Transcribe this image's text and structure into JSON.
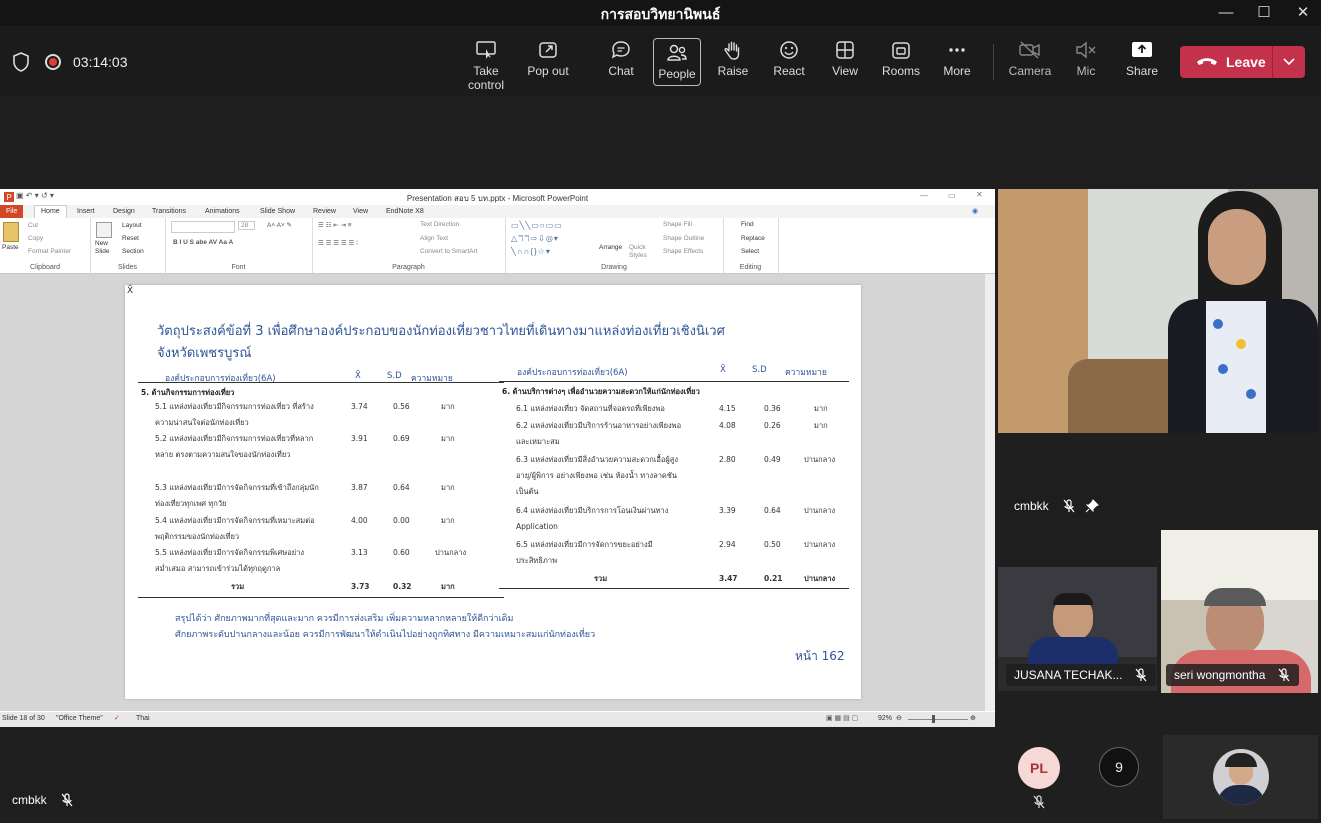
{
  "window": {
    "title": "การสอบวิทยานิพนธ์",
    "minimize": "—",
    "maximize": "☐",
    "close": "✕"
  },
  "call": {
    "timer": "03:14:03"
  },
  "toolbar": {
    "buttons": [
      {
        "label": "Take control",
        "icon": "take-control-icon"
      },
      {
        "label": "Pop out",
        "icon": "pop-out-icon"
      },
      {
        "label": "Chat",
        "icon": "chat-icon"
      },
      {
        "label": "People",
        "icon": "people-icon"
      },
      {
        "label": "Raise",
        "icon": "raise-hand-icon"
      },
      {
        "label": "React",
        "icon": "react-icon"
      },
      {
        "label": "View",
        "icon": "view-icon"
      },
      {
        "label": "Rooms",
        "icon": "rooms-icon"
      },
      {
        "label": "More",
        "icon": "more-icon"
      },
      {
        "label": "Camera",
        "icon": "camera-off-icon"
      },
      {
        "label": "Mic",
        "icon": "mic-off-icon"
      },
      {
        "label": "Share",
        "icon": "share-icon"
      }
    ],
    "leave_label": "Leave",
    "leave_color": "#c4314b"
  },
  "powerpoint": {
    "title": "Presentation สอบ 5 บท.pptx  -  Microsoft PowerPoint",
    "tabs": [
      "File",
      "Home",
      "Insert",
      "Design",
      "Transitions",
      "Animations",
      "Slide Show",
      "Review",
      "View",
      "EndNote X8"
    ],
    "ribbon": {
      "clipboard": {
        "paste": "Paste",
        "cut": "Cut",
        "copy": "Copy",
        "format_painter": "Format Painter",
        "group": "Clipboard"
      },
      "slides": {
        "new_slide": "New Slide",
        "layout": "Layout",
        "reset": "Reset",
        "section": "Section",
        "group": "Slides"
      },
      "font": {
        "size": "28",
        "group": "Font"
      },
      "paragraph": {
        "text_direction": "Text Direction",
        "align_text": "Align Text",
        "convert": "Convert to SmartArt",
        "group": "Paragraph"
      },
      "drawing": {
        "arrange": "Arrange",
        "quick_styles": "Quick Styles",
        "shape_fill": "Shape Fill",
        "shape_outline": "Shape Outline",
        "shape_effects": "Shape Effects",
        "group": "Drawing"
      },
      "editing": {
        "find": "Find",
        "replace": "Replace",
        "select": "Select",
        "group": "Editing"
      }
    },
    "status": {
      "slide": "Slide 18 of 30",
      "theme": "\"Office Theme\"",
      "language": "Thai",
      "zoom": "92%"
    }
  },
  "slide": {
    "corner_mark": "X̄",
    "heading_line1": "วัตถุประสงค์ข้อที่ 3 เพื่อศึกษาองค์ประกอบของนักท่องเที่ยวชาวไทยที่เดินทางมาแหล่งท่องเที่ยวเชิงนิเวศ",
    "heading_line2": "จังหวัดเพชรบูรณ์",
    "headers": {
      "component": "องค์ประกอบการท่องเที่ยว(6A)",
      "mean": "X̄",
      "sd": "S.D",
      "meaning": "ความหมาย"
    },
    "left": {
      "section": "5. ด้านกิจกรรมการท่องเที่ยว",
      "rows": [
        {
          "label": "5.1  แหล่งท่องเที่ยวมีกิจกรรมการท่องเที่ยว ที่สร้างความน่าสนใจต่อนักท่องเที่ยว",
          "mean": "3.74",
          "sd": "0.56",
          "meaning": "มาก"
        },
        {
          "label": "5.2  แหล่งท่องเที่ยวมีกิจกรรมการท่องเที่ยวที่หลากหลาย ตรงตามความสนใจของนักท่องเที่ยว",
          "mean": "3.91",
          "sd": "0.69",
          "meaning": "มาก"
        },
        {
          "label": "5.3  แหล่งท่องเที่ยวมีการจัดกิจกรรมที่เข้าถึงกลุ่มนักท่องเที่ยวทุกเพศ ทุกวัย",
          "mean": "3.87",
          "sd": "0.64",
          "meaning": "มาก"
        },
        {
          "label": "5.4  แหล่งท่องเที่ยวมีการจัดกิจกรรมที่เหมาะสมต่อพฤติกรรมของนักท่องเที่ยว",
          "mean": "4.00",
          "sd": "0.00",
          "meaning": "มาก"
        },
        {
          "label": "5.5  แหล่งท่องเที่ยวมีการจัดกิจกรรมพิเศษอย่างสม่ำเสมอ สามารถเข้าร่วมได้ทุกฤดูกาล",
          "mean": "3.13",
          "sd": "0.60",
          "meaning": "ปานกลาง"
        }
      ],
      "total": {
        "label": "รวม",
        "mean": "3.73",
        "sd": "0.32",
        "meaning": "มาก"
      }
    },
    "right": {
      "section": "6. ด้านบริการต่างๆ เพื่ออำนวยความสะดวกให้แก่นักท่องเที่ยว",
      "rows": [
        {
          "label": "6.1  แหล่งท่องเที่ยว จัดสถานที่จอดรถที่เพียงพอ",
          "mean": "4.15",
          "sd": "0.36",
          "meaning": "มาก"
        },
        {
          "label": "6.2  แหล่งท่องเที่ยวมีบริการร้านอาหารอย่างเพียงพอและเหมาะสม",
          "mean": "4.08",
          "sd": "0.26",
          "meaning": "มาก"
        },
        {
          "label": "6.3  แหล่งท่องเที่ยวมีสิ่งอำนวยความสะดวกเอื้อผู้สูงอายุ/ผู้พิการ อย่างเพียงพอ เช่น ห้องน้ำ ทางลาดชัน เป็นต้น",
          "mean": "2.80",
          "sd": "0.49",
          "meaning": "ปานกลาง"
        },
        {
          "label": "6.4  แหล่งท่องเที่ยวมีบริการการโอนเงินผ่านทาง Application",
          "mean": "3.39",
          "sd": "0.64",
          "meaning": "ปานกลาง"
        },
        {
          "label": "6.5  แหล่งท่องเที่ยวมีการจัดการขยะอย่างมีประสิทธิภาพ",
          "mean": "2.94",
          "sd": "0.50",
          "meaning": "ปานกลาง"
        }
      ],
      "total": {
        "label": "รวม",
        "mean": "3.47",
        "sd": "0.21",
        "meaning": "ปานกลาง"
      }
    },
    "summary1": "สรุปได้ว่า ศักยภาพมากที่สุดและมาก ควรมีการส่งเสริม เพิ่มความหลากหลายให้ดีกว่าเดิม",
    "summary2": "ศักยภาพระดับปานกลางและน้อย ควรมีการพัฒนาให้ดำเนินไปอย่างถูกทิศทาง  มีความเหมาะสมแก่นักท่องเที่ยว",
    "page": "หน้า 162"
  },
  "participants": {
    "main_name": "cmbkk",
    "p1": "JUSANA TECHAK...",
    "p2": "seri wongmontha",
    "pl_initials": "PL",
    "overflow_count": "9",
    "self_name": "cmbkk"
  }
}
